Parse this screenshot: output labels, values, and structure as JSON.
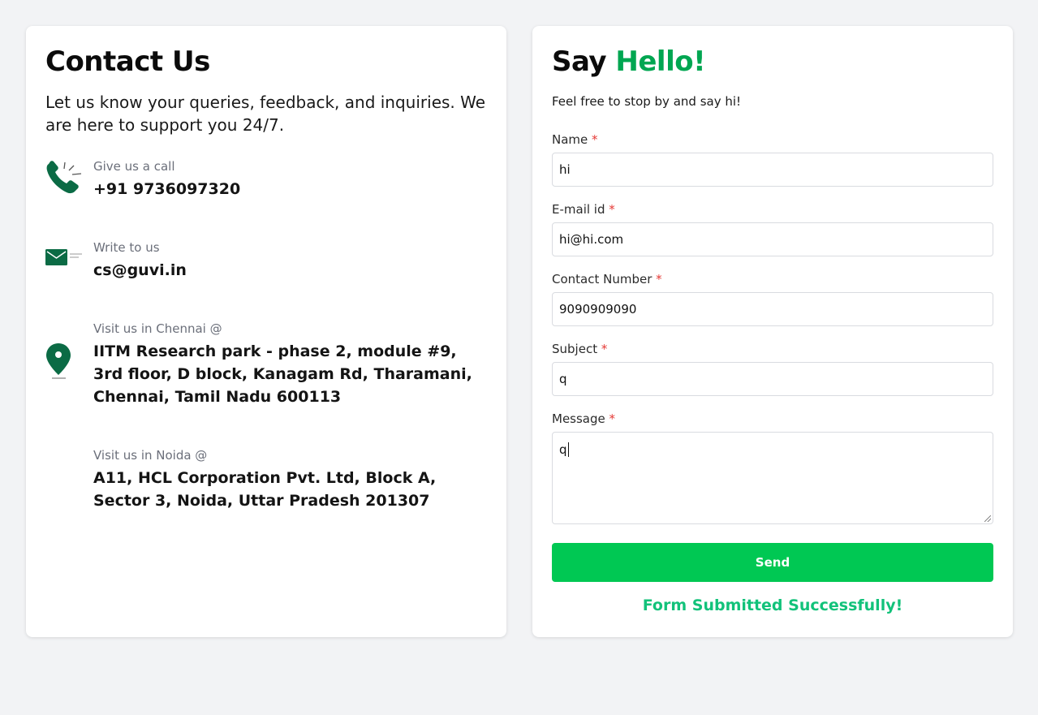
{
  "contact": {
    "title": "Contact Us",
    "intro": "Let us know your queries, feedback, and inquiries. We are here to support you 24/7.",
    "call_label": "Give us a call",
    "call_value": "+91 9736097320",
    "write_label": "Write to us",
    "write_value": "cs@guvi.in",
    "chennai_label": "Visit us in Chennai @",
    "chennai_value": "IITM Research park - phase 2, module #9, 3rd floor, D block, Kanagam Rd, Tharamani, Chennai, Tamil Nadu 600113",
    "noida_label": "Visit us in Noida @",
    "noida_value": "A11, HCL Corporation Pvt. Ltd, Block A, Sector 3, Noida, Uttar Pradesh 201307"
  },
  "form": {
    "title_say": "Say",
    "title_hello": "Hello!",
    "subtitle": "Feel free to stop by and say hi!",
    "required_mark": "*",
    "name_label": "Name",
    "name_value": "hi",
    "email_label": "E-mail id",
    "email_value": "hi@hi.com",
    "contact_label": "Contact Number",
    "contact_value": "9090909090",
    "subject_label": "Subject",
    "subject_value": "q",
    "message_label": "Message",
    "message_value": "q",
    "send_label": "Send",
    "success": "Form Submitted Successfully!"
  },
  "colors": {
    "accent": "#00a651",
    "button": "#00c853",
    "success": "#12c27a",
    "icon": "#0b6b45"
  }
}
